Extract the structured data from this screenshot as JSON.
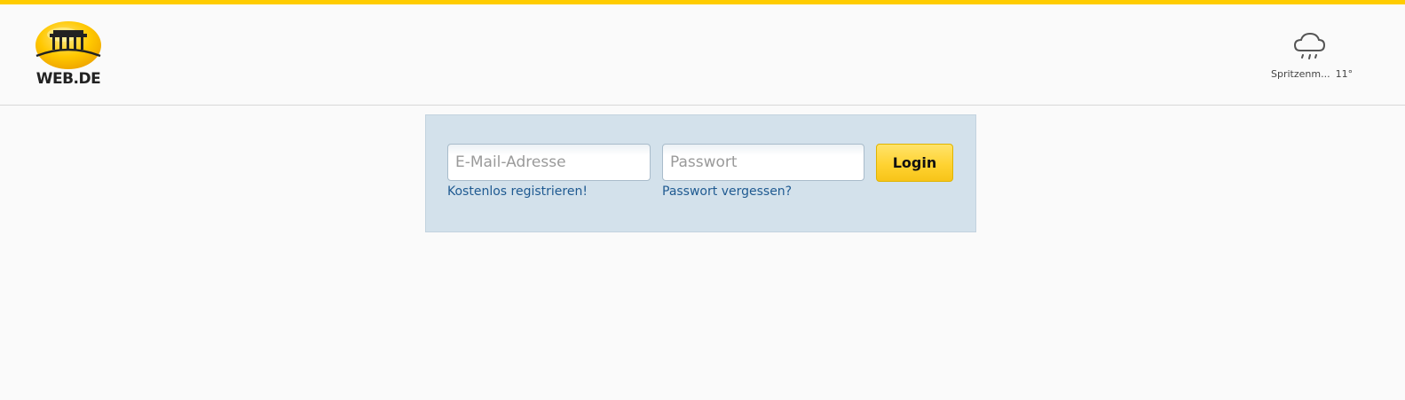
{
  "brand": {
    "logo_text": "WEB.DE",
    "accent_color": "#ffcc00",
    "logo_icon": "brandenburg-gate-icon"
  },
  "weather": {
    "icon": "rain-cloud-icon",
    "location": "Spritzenm...",
    "temperature": "11°"
  },
  "login": {
    "email_placeholder": "E-Mail-Adresse",
    "email_value": "",
    "password_placeholder": "Passwort",
    "password_value": "",
    "submit_label": "Login",
    "register_link": "Kostenlos registrieren!",
    "forgot_link": "Passwort vergessen?",
    "panel_color": "#d3e1eb",
    "link_color": "#1f5a91"
  }
}
